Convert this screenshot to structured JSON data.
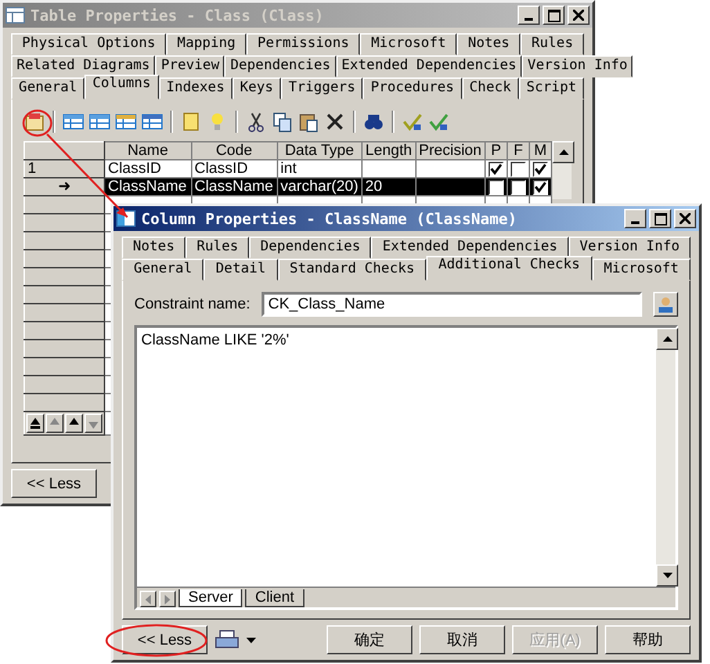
{
  "table_window": {
    "title": "Table Properties - Class (Class)",
    "tab_rows": [
      [
        {
          "label": "Physical Options",
          "selected": false
        },
        {
          "label": "Mapping",
          "selected": false
        },
        {
          "label": "Permissions",
          "selected": false
        },
        {
          "label": "Microsoft",
          "selected": false
        },
        {
          "label": "Notes",
          "selected": false
        },
        {
          "label": "Rules",
          "selected": false
        }
      ],
      [
        {
          "label": "Related Diagrams",
          "selected": false
        },
        {
          "label": "Preview",
          "selected": false
        },
        {
          "label": "Dependencies",
          "selected": false
        },
        {
          "label": "Extended Dependencies",
          "selected": false
        },
        {
          "label": "Version Info",
          "selected": false
        }
      ],
      [
        {
          "label": "General",
          "selected": false
        },
        {
          "label": "Columns",
          "selected": true
        },
        {
          "label": "Indexes",
          "selected": false
        },
        {
          "label": "Keys",
          "selected": false
        },
        {
          "label": "Triggers",
          "selected": false
        },
        {
          "label": "Procedures",
          "selected": false
        },
        {
          "label": "Check",
          "selected": false
        },
        {
          "label": "Script",
          "selected": false
        }
      ]
    ],
    "columns": [
      "Name",
      "Code",
      "Data Type",
      "Length",
      "Precision",
      "P",
      "F",
      "M"
    ],
    "rows": [
      {
        "marker": "1",
        "name": "ClassID",
        "code": "ClassID",
        "data_type": "int",
        "selected": false,
        "p": true,
        "f": false,
        "m": true
      },
      {
        "marker": "➜",
        "name": "ClassName",
        "code": "ClassName",
        "data_type": "varchar(20)",
        "length": "20",
        "selected": true,
        "p": false,
        "f": false,
        "m": true
      }
    ],
    "less_button": "<< Less"
  },
  "column_window": {
    "title": "Column Properties - ClassName (ClassName)",
    "tab_rows": [
      [
        {
          "label": "Notes",
          "selected": false
        },
        {
          "label": "Rules",
          "selected": false
        },
        {
          "label": "Dependencies",
          "selected": false
        },
        {
          "label": "Extended Dependencies",
          "selected": false
        },
        {
          "label": "Version Info",
          "selected": false
        }
      ],
      [
        {
          "label": "General",
          "selected": false
        },
        {
          "label": "Detail",
          "selected": false
        },
        {
          "label": "Standard Checks",
          "selected": false
        },
        {
          "label": "Additional Checks",
          "selected": true
        },
        {
          "label": "Microsoft",
          "selected": false
        }
      ]
    ],
    "constraint_label": "Constraint name:",
    "constraint_value": "CK_Class_Name",
    "expression": "ClassName LIKE '2%'",
    "sheet_tabs": [
      {
        "label": "Server",
        "selected": true
      },
      {
        "label": "Client",
        "selected": false
      }
    ],
    "less_button": "<< Less",
    "buttons": [
      {
        "label": "确定",
        "disabled": false
      },
      {
        "label": "取消",
        "disabled": false
      },
      {
        "label": "应用(A)",
        "disabled": true
      },
      {
        "label": "帮助",
        "disabled": false
      }
    ]
  }
}
